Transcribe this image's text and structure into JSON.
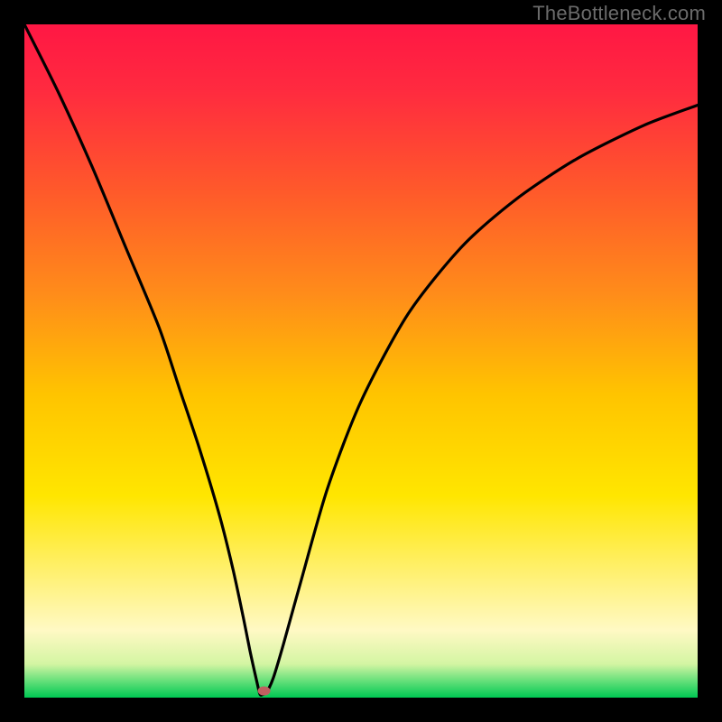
{
  "watermark": "TheBottleneck.com",
  "chart_data": {
    "type": "line",
    "title": "",
    "xlabel": "",
    "ylabel": "",
    "xlim": [
      0,
      100
    ],
    "ylim": [
      0,
      100
    ],
    "grid": false,
    "legend": false,
    "gradient_stops": [
      {
        "offset": 0.0,
        "color": "#ff1744"
      },
      {
        "offset": 0.1,
        "color": "#ff2b3f"
      },
      {
        "offset": 0.25,
        "color": "#ff5a2a"
      },
      {
        "offset": 0.4,
        "color": "#ff8c1a"
      },
      {
        "offset": 0.55,
        "color": "#ffc400"
      },
      {
        "offset": 0.7,
        "color": "#ffe600"
      },
      {
        "offset": 0.82,
        "color": "#fff176"
      },
      {
        "offset": 0.9,
        "color": "#fff9c4"
      },
      {
        "offset": 0.95,
        "color": "#d4f5a3"
      },
      {
        "offset": 0.975,
        "color": "#66e07a"
      },
      {
        "offset": 1.0,
        "color": "#00c853"
      }
    ],
    "series": [
      {
        "name": "bottleneck-curve",
        "x": [
          0,
          5,
          10,
          15,
          20,
          23,
          26,
          29,
          31,
          32.5,
          33.5,
          34.5,
          35.0,
          35.5,
          36.0,
          37.0,
          38.5,
          41.0,
          45.0,
          50,
          57,
          65,
          73,
          82,
          92,
          100
        ],
        "values": [
          100,
          90,
          79,
          67,
          55,
          46,
          37,
          27,
          19,
          12,
          7,
          2.5,
          0.5,
          0.5,
          0.8,
          3,
          8,
          17,
          31,
          44,
          57,
          67,
          74,
          80,
          85,
          88
        ]
      }
    ],
    "marker": {
      "x": 35.6,
      "y": 1.0,
      "color": "#c06060",
      "rx": 7,
      "ry": 5
    }
  }
}
